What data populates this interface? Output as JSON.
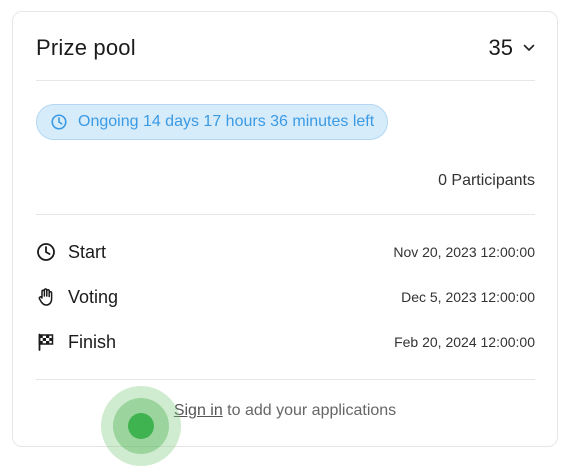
{
  "card": {
    "title": "Prize pool",
    "pool_value": "35",
    "status_badge": "Ongoing 14 days 17 hours 36 minutes left",
    "participants": "0 Participants",
    "schedule": [
      {
        "icon": "clock-icon",
        "label": "Start",
        "date": "Nov 20, 2023 12:00:00"
      },
      {
        "icon": "hand-icon",
        "label": "Voting",
        "date": "Dec 5, 2023 12:00:00"
      },
      {
        "icon": "checkered-flag-icon",
        "label": "Finish",
        "date": "Feb 20, 2024 12:00:00"
      }
    ],
    "signin": {
      "link": "Sign in",
      "rest": " to add your applications"
    }
  },
  "colors": {
    "accent": "#3a9ae4",
    "badge_bg": "#d7ecfb",
    "touch": "#3fb34f"
  }
}
